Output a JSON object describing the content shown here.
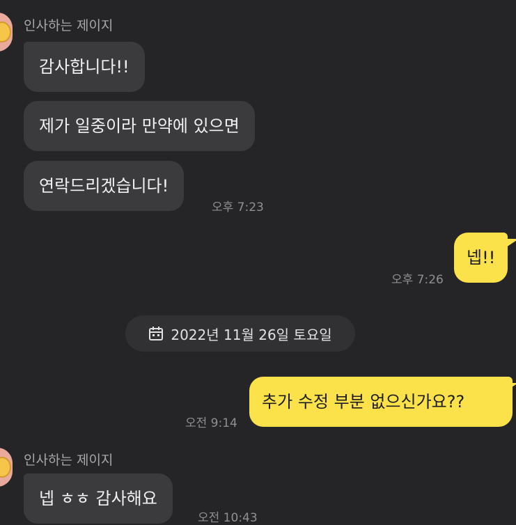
{
  "messages": {
    "group1": {
      "sender": "인사하는 제이지",
      "bubbles": [
        "감사합니다!!",
        "제가 일중이라 만약에 있으면",
        "연락드리겠습니다!"
      ],
      "time": "오후 7:23"
    },
    "reply1": {
      "text": "넵!!",
      "time": "오후 7:26"
    },
    "date_divider": {
      "label": "2022년 11월 26일 토요일"
    },
    "reply2": {
      "text": "추가 수정 부분 없으신가요??",
      "time": "오전 9:14"
    },
    "group2": {
      "sender": "인사하는 제이지",
      "bubbles": [
        "넵 ㅎㅎ 감사해요"
      ],
      "time": "오전 10:43"
    }
  },
  "colors": {
    "background": "#252528",
    "incoming_bubble": "#3b3b3e",
    "outgoing_bubble": "#fbe24b"
  }
}
